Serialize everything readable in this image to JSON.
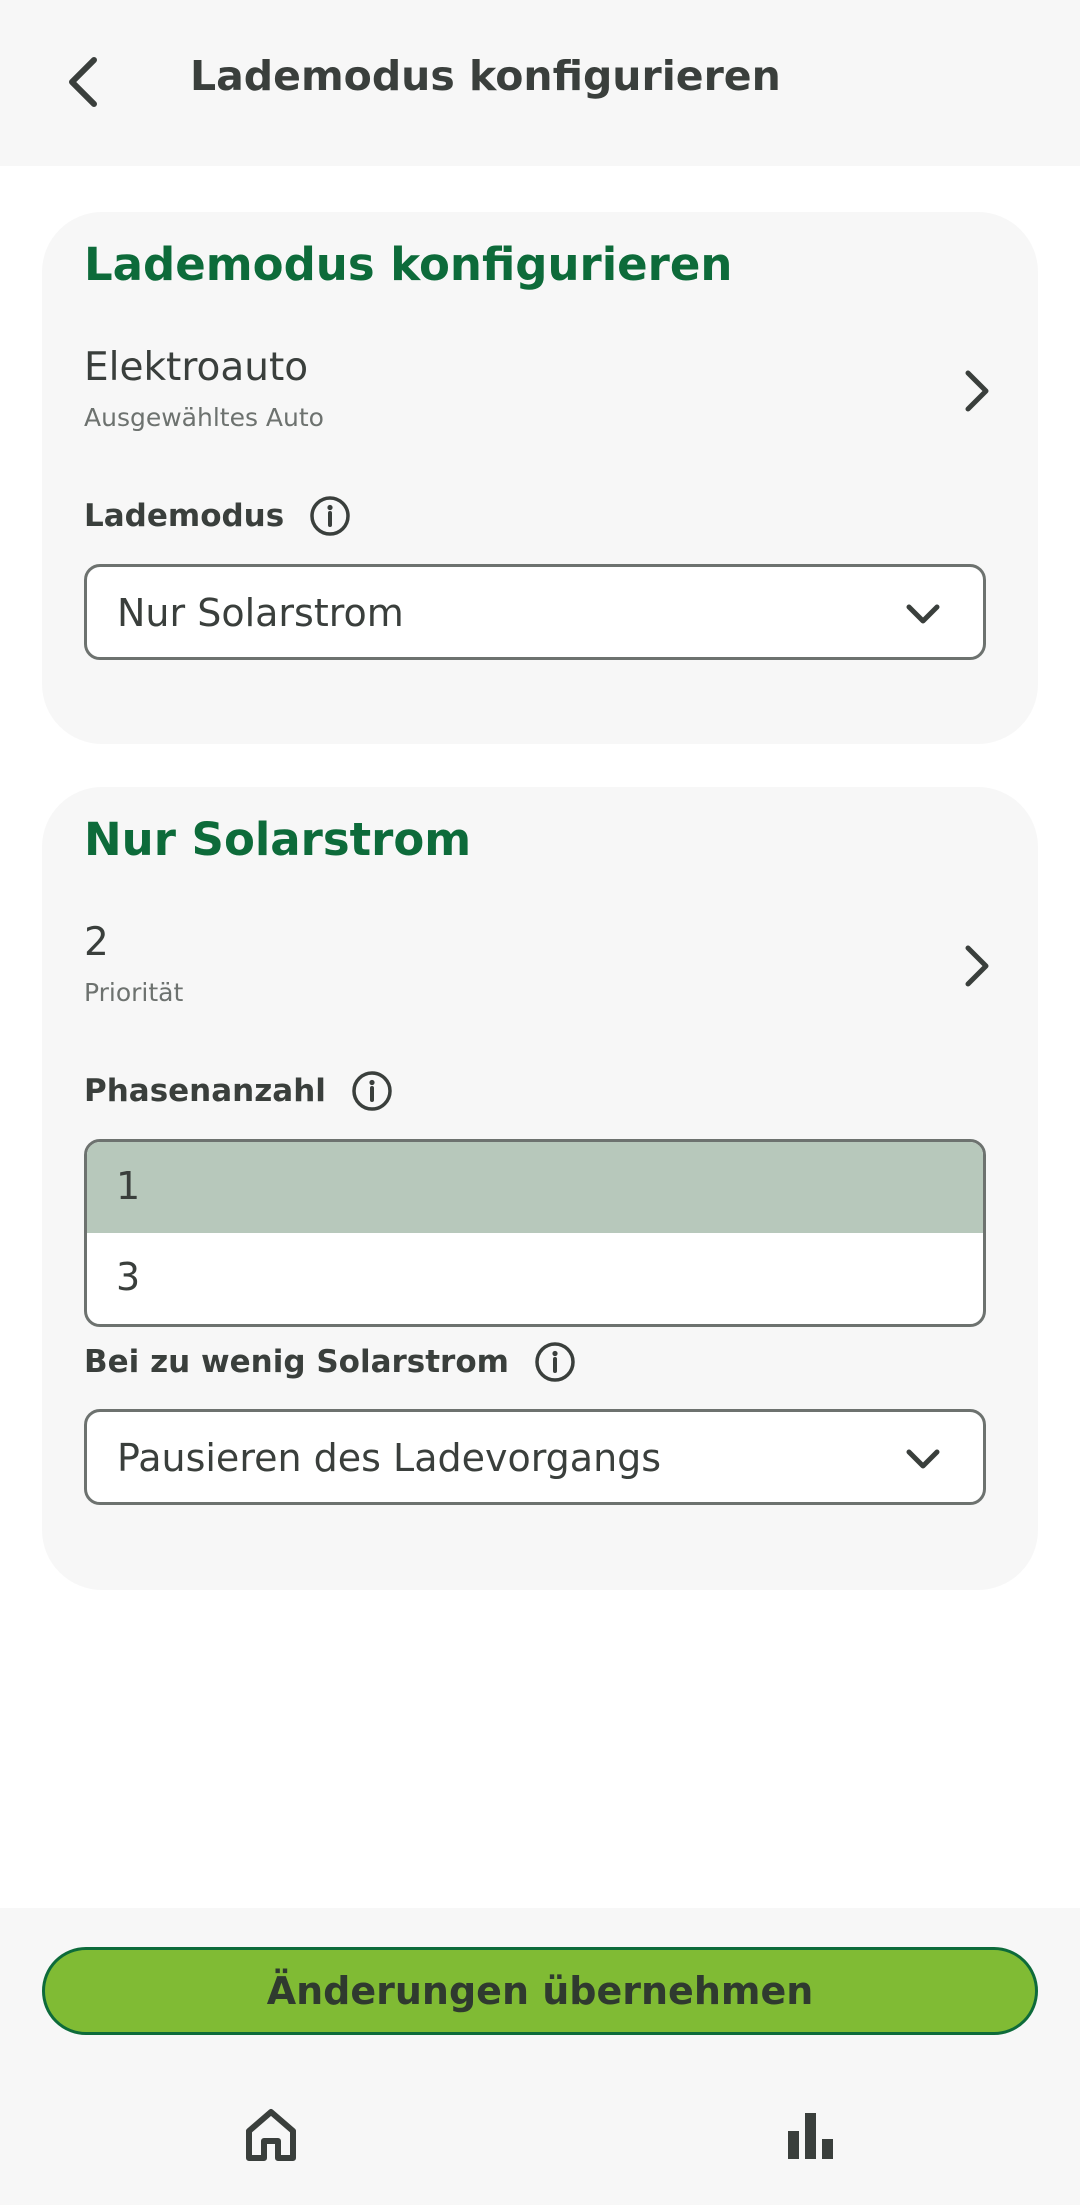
{
  "topbar": {
    "title": "Lademodus konfigurieren"
  },
  "card_config": {
    "title": "Lademodus konfigurieren",
    "car": {
      "value": "Elektroauto",
      "label": "Ausgewähltes Auto"
    },
    "mode": {
      "label": "Lademodus",
      "selected": "Nur Solarstrom"
    }
  },
  "card_solar": {
    "title": "Nur Solarstrom",
    "priority": {
      "value": "2",
      "label": "Priorität"
    },
    "phases": {
      "label": "Phasenanzahl",
      "options": [
        "1",
        "3"
      ],
      "selected": "1"
    },
    "low_solar": {
      "label": "Bei zu wenig Solarstrom",
      "selected": "Pausieren des Ladevorgangs"
    }
  },
  "apply_button": {
    "label": "Änderungen übernehmen"
  },
  "bottom_nav": {
    "icons": [
      "home-icon",
      "bar-chart-icon"
    ]
  },
  "colors": {
    "brand_green": "#0d6b3a",
    "accent_green": "#80bb34",
    "selected_option": "#b7c8bb",
    "surface": "#f7f7f7",
    "text": "#3a3f3c"
  }
}
